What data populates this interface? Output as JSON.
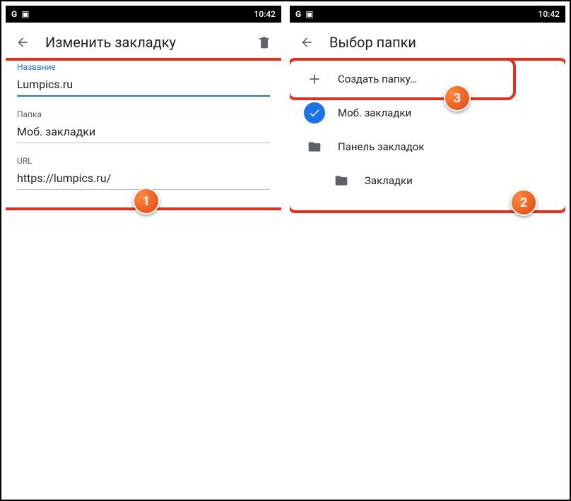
{
  "statusbar": {
    "time": "10:42"
  },
  "left": {
    "title": "Изменить закладку",
    "fields": {
      "name_label": "Название",
      "name_value": "Lumpics.ru",
      "folder_label": "Папка",
      "folder_value": "Моб. закладки",
      "url_label": "URL",
      "url_value": "https://lumpics.ru/"
    }
  },
  "right": {
    "title": "Выбор папки",
    "items": [
      {
        "label": "Создать папку…",
        "icon": "plus"
      },
      {
        "label": "Моб. закладки",
        "icon": "check"
      },
      {
        "label": "Панель закладок",
        "icon": "folder"
      },
      {
        "label": "Закладки",
        "icon": "folder",
        "indent": true
      }
    ]
  },
  "badges": {
    "one": "1",
    "two": "2",
    "three": "3"
  }
}
